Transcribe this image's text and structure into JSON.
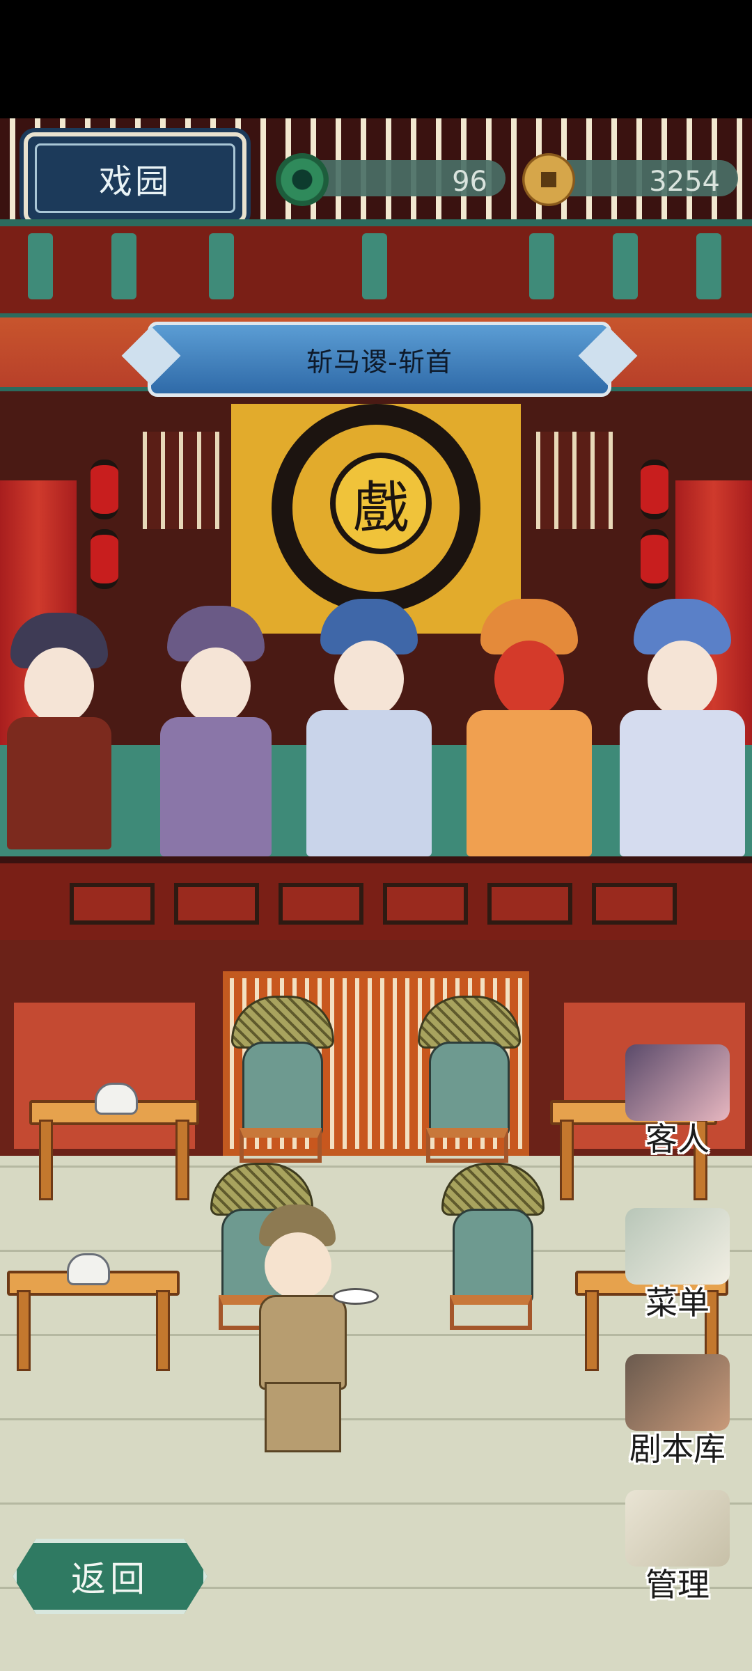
{
  "header": {
    "title": "戏园",
    "jade_count": "96",
    "coin_count": "3254"
  },
  "stage": {
    "play_title": "斩马谡-斩首",
    "backdrop_glyph": "戲"
  },
  "side_menu": [
    {
      "label": "客人",
      "icon": "guests-icon"
    },
    {
      "label": "菜单",
      "icon": "menu-icon"
    },
    {
      "label": "剧本库",
      "icon": "script-library-icon"
    },
    {
      "label": "管理",
      "icon": "manage-icon"
    }
  ],
  "footer": {
    "back_label": "返回"
  },
  "colors": {
    "plaque": "#1c3a5a",
    "banner": "#2f6aa8",
    "stage_floor": "#3e8a78",
    "back_button": "#2f7a62"
  }
}
